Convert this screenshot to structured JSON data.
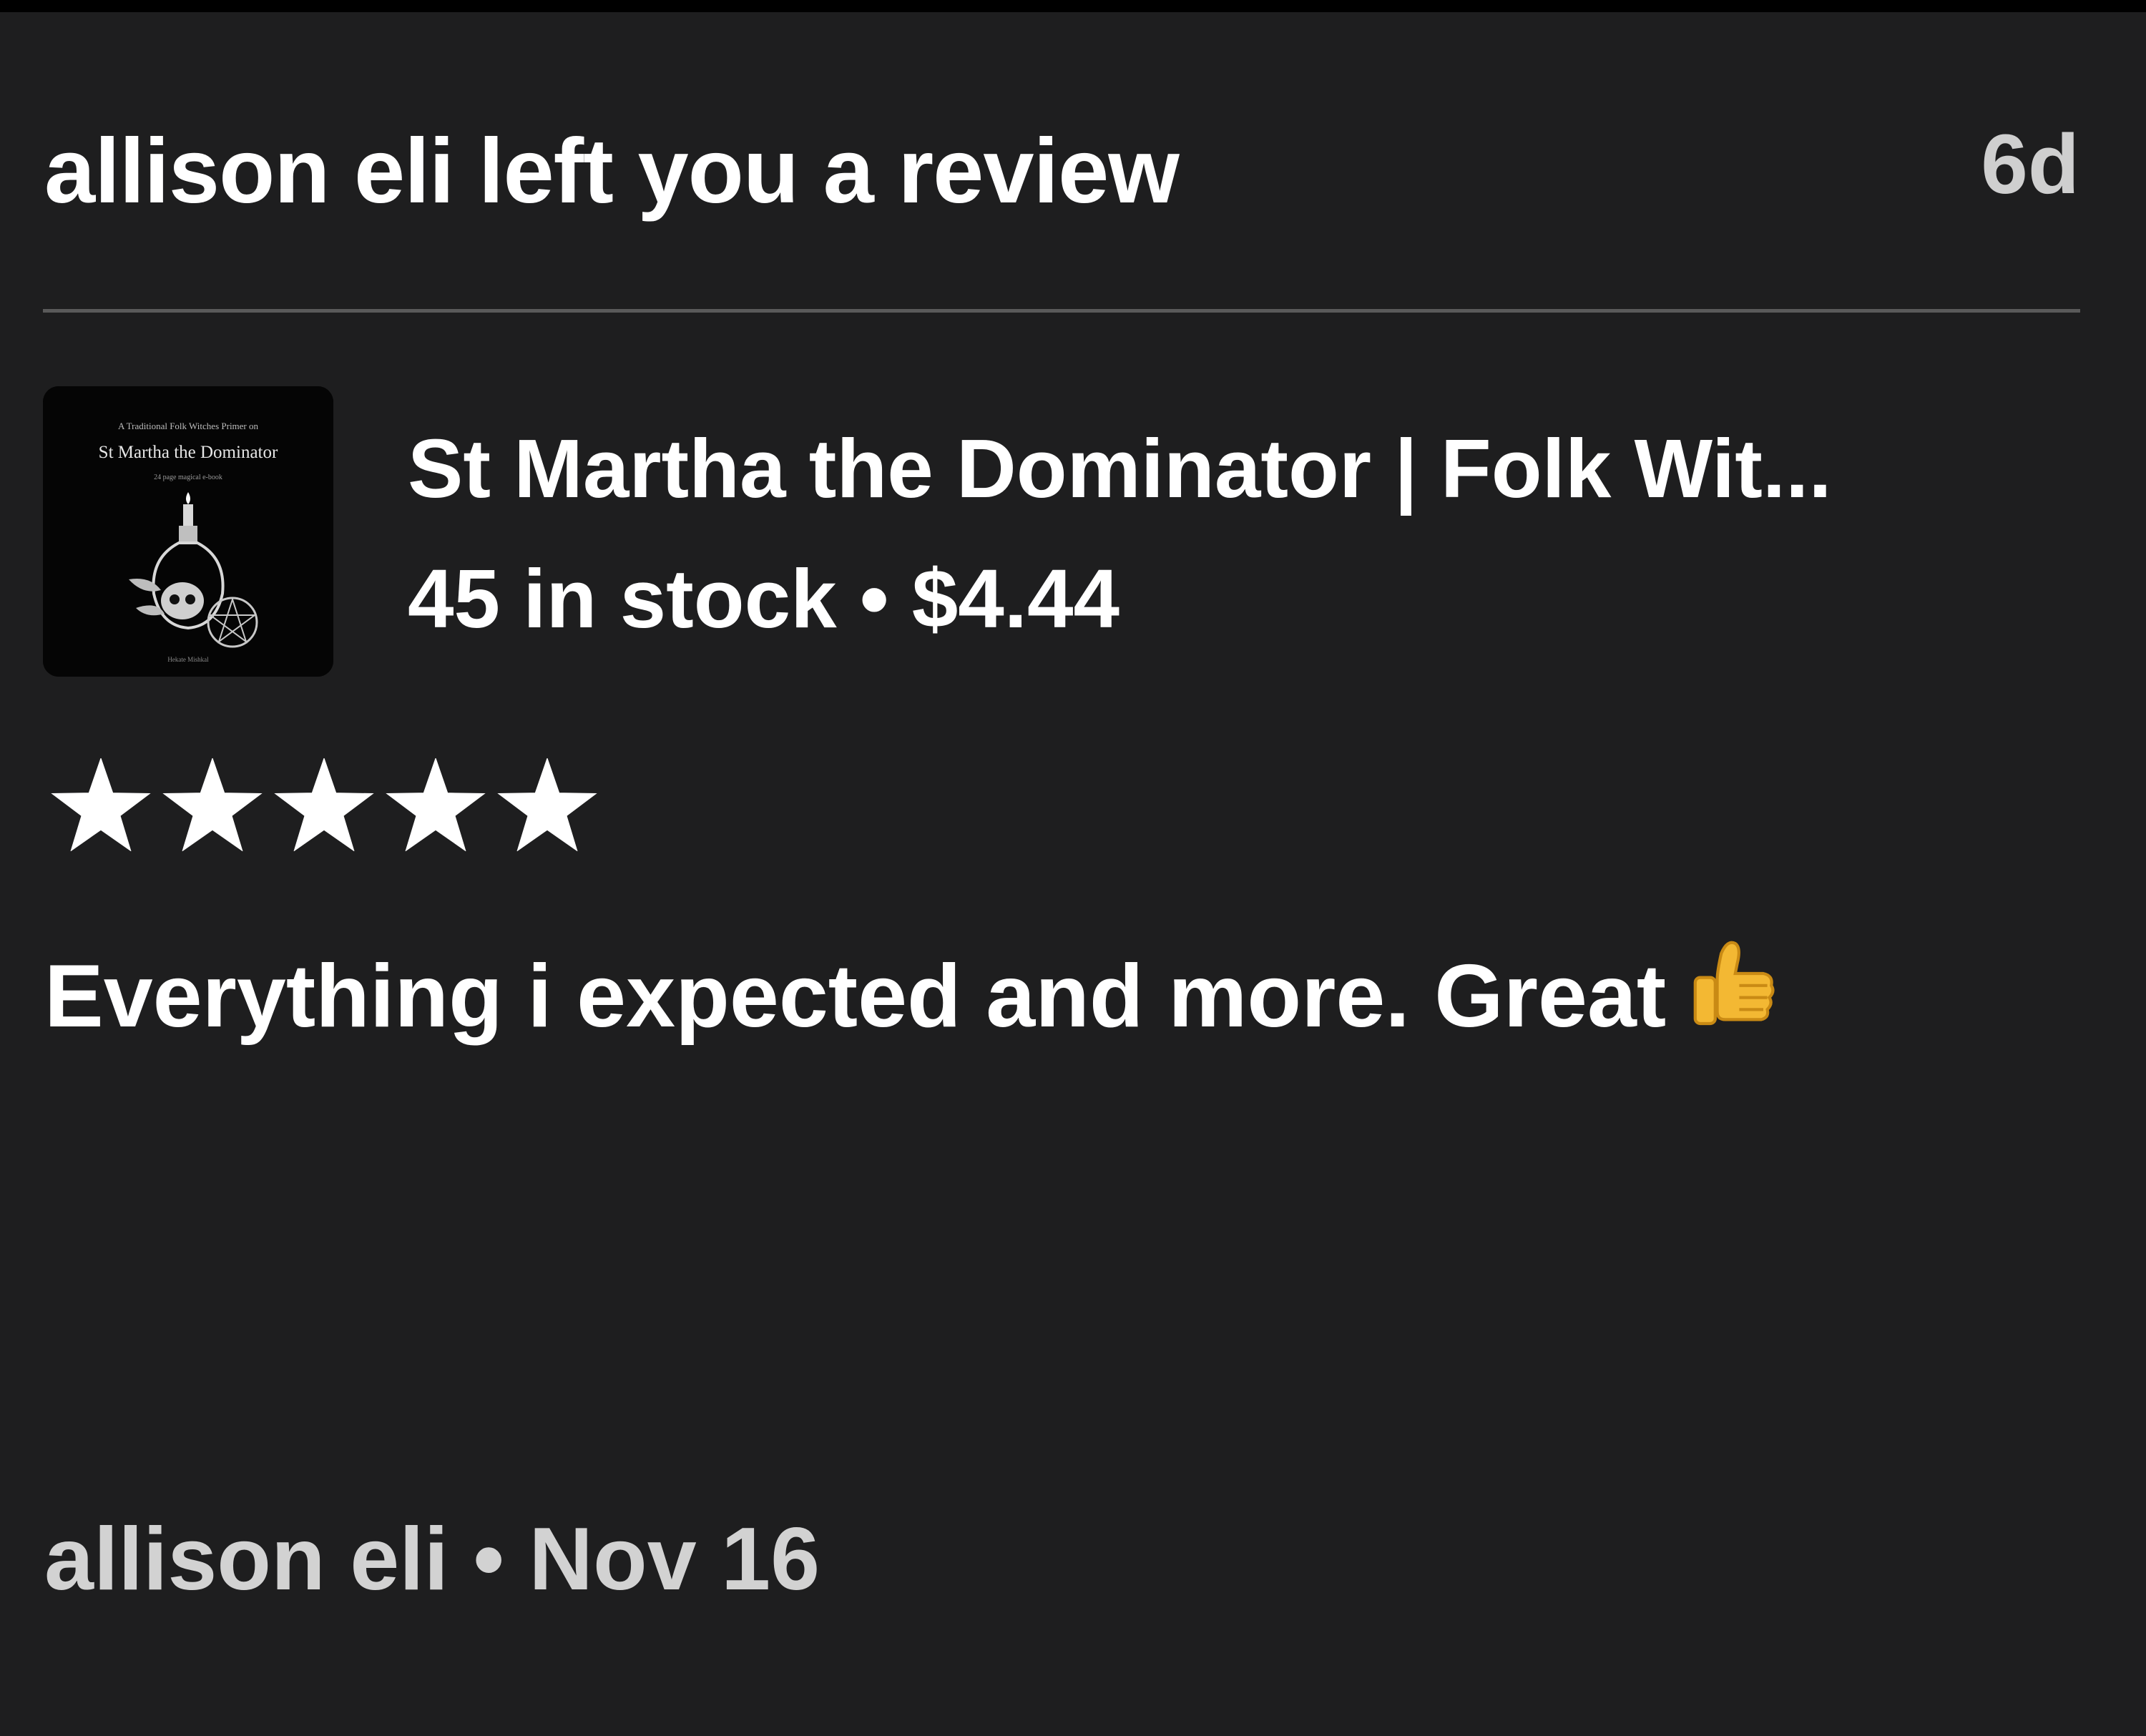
{
  "notification": {
    "title": "allison eli left you a review",
    "age": "6d"
  },
  "listing": {
    "title": "St Martha the Dominator | Folk Wit...",
    "stock": "45 in stock",
    "separator": "•",
    "price": "$4.44",
    "thumbnail": {
      "top_line": "A Traditional Folk Witches Primer on",
      "name": "St Martha the Dominator",
      "sub_line": "24 page magical e-book",
      "bottom_line": "Hekate Mishkal"
    }
  },
  "review": {
    "rating": 5,
    "rating_max": 5,
    "text": "Everything i expected and more. Great",
    "emoji": "thumbs-up",
    "author": "allison eli",
    "separator": "•",
    "date": "Nov 16"
  },
  "colors": {
    "background": "#1e1e1f",
    "text_primary": "#ffffff",
    "text_secondary": "#d2d2d2",
    "divider": "#5a5a5a",
    "star": "#ffffff"
  }
}
